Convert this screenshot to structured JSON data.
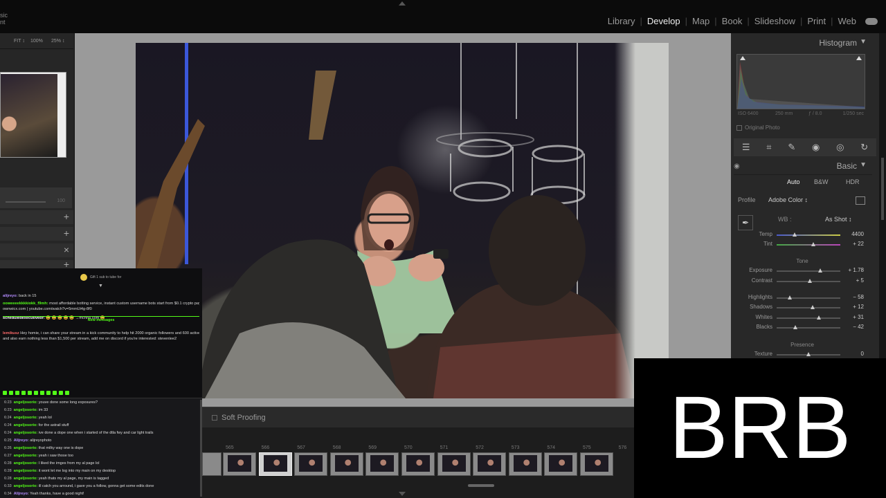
{
  "identity_plate": [
    "sic",
    "nt"
  ],
  "modules": [
    {
      "label": "Library",
      "active": false
    },
    {
      "label": "Develop",
      "active": true
    },
    {
      "label": "Map",
      "active": false
    },
    {
      "label": "Book",
      "active": false
    },
    {
      "label": "Slideshow",
      "active": false
    },
    {
      "label": "Print",
      "active": false
    },
    {
      "label": "Web",
      "active": false
    }
  ],
  "navigator": {
    "zoom_options": [
      "FIT ↕",
      "100%",
      "25% ↕"
    ],
    "slider_value": "100"
  },
  "center": {
    "soft_proofing_label": "Soft Proofing"
  },
  "filmstrip": {
    "numbers": [
      "565",
      "566",
      "567",
      "568",
      "569",
      "570",
      "571",
      "572",
      "573",
      "574",
      "575",
      "576"
    ],
    "selected_index": 1
  },
  "histogram": {
    "title": "Histogram",
    "iso": "ISO 6400",
    "focal": "250 mm",
    "aperture": "ƒ / 8.0",
    "shutter": "1/250 sec",
    "original_photo_label": "Original Photo"
  },
  "basic": {
    "title": "Basic",
    "treatment": [
      "Auto",
      "B&W",
      "HDR"
    ],
    "profile_label": "Profile",
    "profile_value": "Adobe Color ↕",
    "wb_label": "WB :",
    "wb_value": "As Shot ↕",
    "tone_label": "Tone",
    "presence_label": "Presence",
    "sliders": {
      "temp": {
        "label": "Temp",
        "value": "4400",
        "pos": 0.28
      },
      "tint": {
        "label": "Tint",
        "value": "+ 22",
        "pos": 0.58
      },
      "exposure": {
        "label": "Exposure",
        "value": "+ 1.78",
        "pos": 0.68
      },
      "contrast": {
        "label": "Contrast",
        "value": "+ 5",
        "pos": 0.52
      },
      "highlights": {
        "label": "Highlights",
        "value": "− 58",
        "pos": 0.21
      },
      "shadows": {
        "label": "Shadows",
        "value": "+ 12",
        "pos": 0.56
      },
      "whites": {
        "label": "Whites",
        "value": "+ 31",
        "pos": 0.66
      },
      "blacks": {
        "label": "Blacks",
        "value": "− 42",
        "pos": 0.29
      },
      "texture": {
        "label": "Texture",
        "value": "0",
        "pos": 0.5
      }
    }
  },
  "chat": {
    "gift_text": "Gift 1 sub to tube for",
    "messages": [
      {
        "user": "alijreyo:",
        "text": "back in 15",
        "color": "#b48cff"
      },
      {
        "user": "ooweeeekkkkiokk_f9mh:",
        "text": "most affordable botting service, instant custom username bots start from $0.1 crypto payments.",
        "color": "#53fc18"
      },
      {
        "user": "",
        "text": "ownwicx.com | youtube.com/watch?v=5mmUi4g-8f0",
        "color": "#53fc18"
      },
      {
        "user": "scheduledexecutivedr:",
        "text": "😀 😀 😀 😀 😀 →mchna.com 😀",
        "color": "#fff"
      },
      {
        "user": "lemikusz",
        "text": "Hey homie, i can share your stream in a kick community to help hit 2000 organic followers and 600 active viewers",
        "color": "#ff6b6b"
      },
      {
        "user": "",
        "text": "and also earn nothing less than $1,500 per stream, add me on discord if you're interested: stevenlee2",
        "color": "#ff6b6b"
      }
    ],
    "new_messages_label": "New messages",
    "log": [
      {
        "time": "6:23",
        "user": "angeljosorio:",
        "text": "youve done some long exposures?"
      },
      {
        "time": "6:23",
        "user": "angeljosorio:",
        "text": "im 33"
      },
      {
        "time": "6:24",
        "user": "angeljosorio:",
        "text": "yeah lol"
      },
      {
        "time": "6:24",
        "user": "angeljosorio:",
        "text": "for the astrail stuff"
      },
      {
        "time": "6:24",
        "user": "angeljosorio:",
        "text": "ive done a dope one when i started of the dtla fwy and car light trails"
      },
      {
        "time": "6:25",
        "user": "Alijreyo:",
        "text": "alijreyophoto"
      },
      {
        "time": "6:26",
        "user": "angeljosorio:",
        "text": "that milky way one is dope"
      },
      {
        "time": "6:27",
        "user": "angeljosorio:",
        "text": "yeah i saw those too"
      },
      {
        "time": "6:28",
        "user": "angeljosorio:",
        "text": "I liked the imges from my al page lol"
      },
      {
        "time": "6:28",
        "user": "angeljosorio:",
        "text": "it wont let me log into my main on my desktop"
      },
      {
        "time": "6:28",
        "user": "angeljosorio:",
        "text": "yeah thats my al page, my main is tagged"
      },
      {
        "time": "6:33",
        "user": "angeljosorio:",
        "text": "ill catch you arround, i gave you a follow, gonna get some edits done"
      },
      {
        "time": "6:34",
        "user": "Alijreyo:",
        "text": "Yeah thanks, have a good night!"
      }
    ]
  },
  "overlay": {
    "brb": "BRB"
  },
  "colors": {
    "accent_green": "#53fc18",
    "panel": "#282828",
    "background": "#9a9a9a"
  }
}
